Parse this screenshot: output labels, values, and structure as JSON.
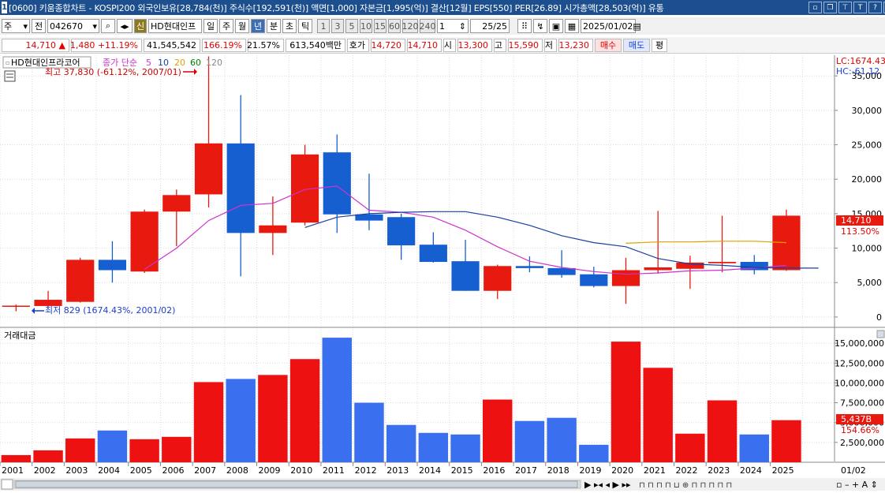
{
  "titlebar": {
    "screen_no": "1",
    "text": "[0600] 키움종합차트 - KOSPI200 외국인보유[28,784(천)] 주식수[192,591(천)] 액면[1,000] 자본금[1,995(억)] 결산[12월] EPS[550] PER[26.89] 시가총액[28,503(억)] 유통"
  },
  "toolbar": {
    "period_type": "주",
    "all_label": "전",
    "code": "042670",
    "new_label": "신",
    "stock_name": "HD현대인프",
    "periods": [
      "일",
      "주",
      "월",
      "년",
      "분",
      "초",
      "틱"
    ],
    "active_period": "년",
    "minute_buttons": [
      "1",
      "3",
      "5",
      "10",
      "15",
      "60",
      "120",
      "240"
    ],
    "count": "1",
    "range": "25/25",
    "date": "2025/01/02"
  },
  "quote": {
    "price": "14,710",
    "change": "1,480",
    "change_rate": "+11.19%",
    "volume": "41,545,542",
    "vol_rate": "166.19%",
    "turnover": "21.57%",
    "amount": "613,540백만",
    "hoga_label": "호가",
    "ask": "14,720",
    "bid": "14,710",
    "open_label": "시",
    "open": "13,300",
    "high_label": "고",
    "high": "15,590",
    "low_label": "저",
    "low": "13,230",
    "buy": "매수",
    "sell": "매도",
    "avg": "평"
  },
  "chart_data": {
    "type": "bar",
    "price_panel": {
      "title": "HD현대인프라코어",
      "ma_label": "종가 단순",
      "ma_periods": [
        {
          "period": "5",
          "color": "#cc33cc"
        },
        {
          "period": "10",
          "color": "#1a3fa0"
        },
        {
          "period": "20",
          "color": "#e0a000"
        },
        {
          "period": "60",
          "color": "#008000"
        },
        {
          "period": "120",
          "color": "#888888"
        }
      ],
      "ylim": [
        -1500,
        38000
      ],
      "yticks": [
        0,
        5000,
        10000,
        15000,
        20000,
        25000,
        30000,
        35000
      ],
      "ytick_labels": [
        "0",
        "5,000",
        "10,000",
        "15,000",
        "20,000",
        "25,000",
        "30,000",
        "35,000"
      ],
      "max_annotation": "최고 37,830 (-61.12%, 2007/01)",
      "min_annotation": "최저 829 (1674.43%, 2001/02)",
      "lc": "LC:1674.43",
      "hc": "HC:-61.12",
      "last_price_tag": "14,710",
      "last_rate_tag": "113.50%",
      "candles": [
        {
          "year": "2001",
          "open": 1600,
          "high": 1800,
          "low": 829,
          "close": 1650
        },
        {
          "year": "2002",
          "open": 1600,
          "high": 3800,
          "low": 1500,
          "close": 2500
        },
        {
          "year": "2003",
          "open": 2200,
          "high": 8600,
          "low": 2100,
          "close": 8300
        },
        {
          "year": "2004",
          "open": 8300,
          "high": 11000,
          "low": 5000,
          "close": 6800
        },
        {
          "year": "2005",
          "open": 6600,
          "high": 15600,
          "low": 6400,
          "close": 15300
        },
        {
          "year": "2006",
          "open": 15300,
          "high": 18500,
          "low": 10300,
          "close": 17700
        },
        {
          "year": "2007",
          "open": 17800,
          "high": 37830,
          "low": 15900,
          "close": 25200
        },
        {
          "year": "2008",
          "open": 25200,
          "high": 32200,
          "low": 5900,
          "close": 12200
        },
        {
          "year": "2009",
          "open": 12200,
          "high": 17500,
          "low": 9000,
          "close": 13300
        },
        {
          "year": "2010",
          "open": 13700,
          "high": 25000,
          "low": 13300,
          "close": 23600
        },
        {
          "year": "2011",
          "open": 23900,
          "high": 26500,
          "low": 12200,
          "close": 14900
        },
        {
          "year": "2012",
          "open": 14900,
          "high": 20800,
          "low": 12600,
          "close": 14000
        },
        {
          "year": "2013",
          "open": 14500,
          "high": 15000,
          "low": 8300,
          "close": 10400
        },
        {
          "year": "2014",
          "open": 10500,
          "high": 12300,
          "low": 7900,
          "close": 8000
        },
        {
          "year": "2015",
          "open": 8100,
          "high": 11200,
          "low": 3800,
          "close": 3800
        },
        {
          "year": "2016",
          "open": 3800,
          "high": 7600,
          "low": 2600,
          "close": 7400
        },
        {
          "year": "2017",
          "open": 7400,
          "high": 8800,
          "low": 6500,
          "close": 7100
        },
        {
          "year": "2018",
          "open": 7100,
          "high": 9700,
          "low": 5700,
          "close": 6100
        },
        {
          "year": "2019",
          "open": 6200,
          "high": 7300,
          "low": 4300,
          "close": 4500
        },
        {
          "year": "2020",
          "open": 4500,
          "high": 8600,
          "low": 1900,
          "close": 6800
        },
        {
          "year": "2021",
          "open": 6800,
          "high": 15400,
          "low": 6300,
          "close": 7200
        },
        {
          "year": "2022",
          "open": 7000,
          "high": 8900,
          "low": 4100,
          "close": 7900
        },
        {
          "year": "2023",
          "open": 7800,
          "high": 14700,
          "low": 6500,
          "close": 8000
        },
        {
          "year": "2024",
          "open": 8000,
          "high": 9000,
          "low": 6200,
          "close": 6800
        },
        {
          "year": "2025",
          "open": 6800,
          "high": 15590,
          "low": 6700,
          "close": 14710
        }
      ],
      "ma_lines": [
        {
          "period": "5",
          "color": "#cc33cc",
          "start_index": 4,
          "values": [
            6900,
            10000,
            14000,
            16200,
            16500,
            18500,
            19000,
            15500,
            15200,
            14500,
            12600,
            10200,
            8100,
            7200,
            6600,
            6200,
            6400,
            6700,
            6800,
            7100,
            7500
          ]
        },
        {
          "period": "10",
          "color": "#1a3fa0",
          "start_index": 9,
          "values": [
            13000,
            14500,
            15000,
            15200,
            15300,
            15300,
            14500,
            13300,
            11800,
            10800,
            10200,
            8500,
            7700,
            7500,
            7200,
            7100,
            7100
          ]
        },
        {
          "period": "20",
          "color": "#e0a000",
          "start_index": 19,
          "values": [
            10700,
            10900,
            10900,
            11000,
            11000,
            10800
          ]
        }
      ]
    },
    "volume_panel": {
      "title": "거래대금",
      "ylim": [
        0,
        17000000
      ],
      "yticks": [
        2500000,
        5000000,
        7500000,
        10000000,
        12500000,
        15000000
      ],
      "ytick_labels": [
        "2,500,000",
        "5,000,000",
        "7,500,000",
        "10,000,000",
        "12,500,000",
        "15,000,000"
      ],
      "last_value_tag": "5,437B",
      "last_rate_tag": "154.66%",
      "values": [
        900000,
        1500000,
        3000000,
        4000000,
        2900000,
        3200000,
        10100000,
        10500000,
        11000000,
        13000000,
        15700000,
        7500000,
        4700000,
        3700000,
        3500000,
        7900000,
        5200000,
        5600000,
        2200000,
        15200000,
        11900000,
        3600000,
        7800000,
        3500000,
        5300000
      ]
    },
    "x_labels": [
      "2001",
      "2002",
      "2003",
      "2004",
      "2005",
      "2006",
      "2007",
      "2008",
      "2009",
      "2010",
      "2011",
      "2012",
      "2013",
      "2014",
      "2015",
      "2016",
      "2017",
      "2018",
      "2019",
      "2020",
      "2021",
      "2022",
      "2023",
      "2024",
      "2025"
    ],
    "x_right_label": "01/02",
    "colors": {
      "up": "#e8190f",
      "down": "#165fd0",
      "vol_up": "#ee1111",
      "vol_down": "#3a6ff0"
    }
  }
}
